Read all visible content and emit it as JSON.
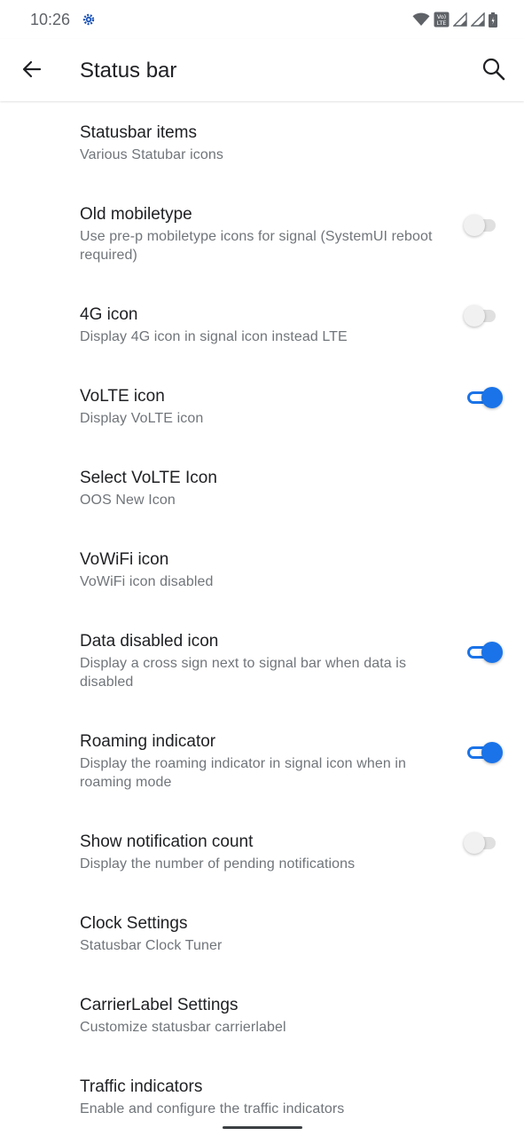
{
  "status_bar": {
    "time": "10:26",
    "volte_badge_top": "Vo)",
    "volte_badge_bottom": "LTE"
  },
  "app_bar": {
    "title": "Status bar"
  },
  "colors": {
    "accent": "#1a73e8",
    "title_text": "#202124",
    "summary_text": "#70757a"
  },
  "items": [
    {
      "title": "Statusbar items",
      "summary": "Various Statubar icons",
      "toggle": null
    },
    {
      "title": "Old mobiletype",
      "summary": "Use pre-p mobiletype icons for signal (SystemUI reboot required)",
      "toggle": false
    },
    {
      "title": "4G icon",
      "summary": "Display 4G icon in signal icon instead LTE",
      "toggle": false
    },
    {
      "title": "VoLTE icon",
      "summary": "Display VoLTE icon",
      "toggle": true
    },
    {
      "title": "Select VoLTE Icon",
      "summary": "OOS New Icon",
      "toggle": null
    },
    {
      "title": "VoWiFi icon",
      "summary": "VoWiFi icon disabled",
      "toggle": null
    },
    {
      "title": "Data disabled icon",
      "summary": "Display a cross sign next to signal bar when data is disabled",
      "toggle": true
    },
    {
      "title": "Roaming indicator",
      "summary": "Display the roaming indicator in signal icon when in roaming mode",
      "toggle": true
    },
    {
      "title": "Show notification count",
      "summary": "Display the number of pending notifications",
      "toggle": false
    },
    {
      "title": "Clock Settings",
      "summary": "Statusbar Clock Tuner",
      "toggle": null
    },
    {
      "title": "CarrierLabel Settings",
      "summary": "Customize statusbar carrierlabel",
      "toggle": null
    },
    {
      "title": "Traffic indicators",
      "summary": "Enable and configure the traffic indicators",
      "toggle": null
    }
  ]
}
